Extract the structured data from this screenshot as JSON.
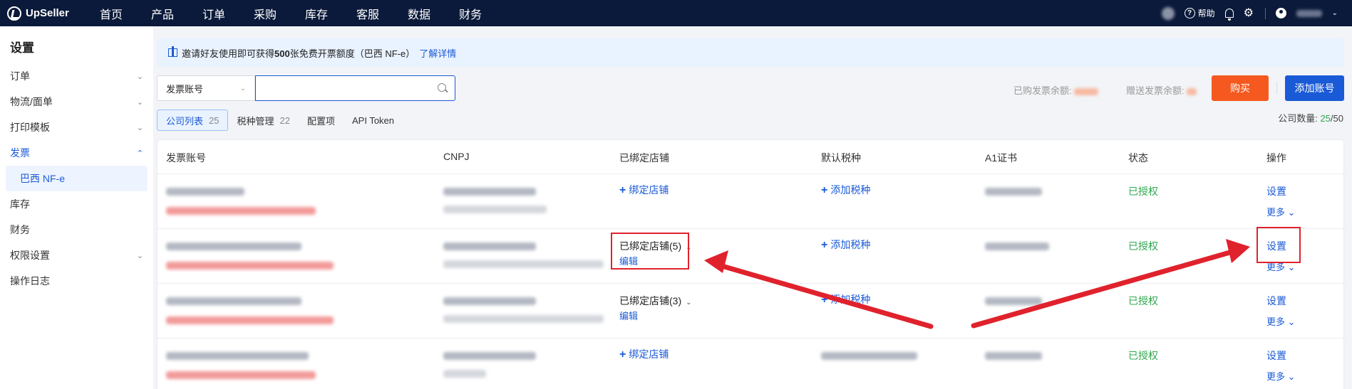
{
  "topbar": {
    "brand": "UpSeller",
    "nav": [
      "首页",
      "产品",
      "订单",
      "采购",
      "库存",
      "客服",
      "数据",
      "财务"
    ],
    "help_label": "帮助"
  },
  "sidebar": {
    "title": "设置",
    "items": [
      {
        "label": "订单",
        "arrow": "⌄"
      },
      {
        "label": "物流/面单",
        "arrow": "⌄"
      },
      {
        "label": "打印模板",
        "arrow": "⌄"
      },
      {
        "label": "发票",
        "arrow": "⌃"
      },
      {
        "label": "巴西 NF-e"
      },
      {
        "label": "库存"
      },
      {
        "label": "财务"
      },
      {
        "label": "权限设置",
        "arrow": "⌄"
      },
      {
        "label": "操作日志"
      }
    ]
  },
  "banner": {
    "text_pre": "邀请好友使用即可获得",
    "text_bold": "500",
    "text_post": "张免费开票额度（巴西 NF-e）",
    "link": "了解详情"
  },
  "toolbar": {
    "select_value": "发票账号",
    "search_value": "",
    "purchased_label": "已购发票余额: ",
    "gift_label": "赠送发票余额: ",
    "buy_button": "购买",
    "add_button": "添加账号"
  },
  "tabs": [
    {
      "label": "公司列表",
      "count": "25"
    },
    {
      "label": "税种管理",
      "count": "22"
    },
    {
      "label": "配置项",
      "count": ""
    },
    {
      "label": "API Token",
      "count": ""
    }
  ],
  "company_count": {
    "label": "公司数量: ",
    "current": "25",
    "total": "/50"
  },
  "table": {
    "headers": [
      "发票账号",
      "CNPJ",
      "已绑定店铺",
      "默认税种",
      "A1证书",
      "状态",
      "操作"
    ],
    "rows": [
      {
        "bound_text": "绑定店铺",
        "bound_type": "link",
        "tax": "添加税种",
        "tax_type": "link",
        "status": "已授权",
        "action": "设置",
        "more": "更多"
      },
      {
        "bound_text": "已绑定店铺(5)",
        "bound_type": "bound",
        "edit": "编辑",
        "tax": "添加税种",
        "tax_type": "link",
        "status": "已授权",
        "action": "设置",
        "more": "更多"
      },
      {
        "bound_text": "已绑定店铺(3)",
        "bound_type": "bound",
        "edit": "编辑",
        "tax": "添加税种",
        "tax_type": "link",
        "status": "已授权",
        "action": "设置",
        "more": "更多"
      },
      {
        "bound_text": "绑定店铺",
        "bound_type": "link",
        "tax": "",
        "tax_type": "blurred",
        "status": "已授权",
        "action": "设置",
        "more": "更多"
      }
    ]
  },
  "colors": {
    "nav_bg": "#0b1a3a",
    "accent": "#1a5ad7",
    "buy": "#f5591f",
    "success": "#2fa84f",
    "annotation": "#e0222c"
  }
}
